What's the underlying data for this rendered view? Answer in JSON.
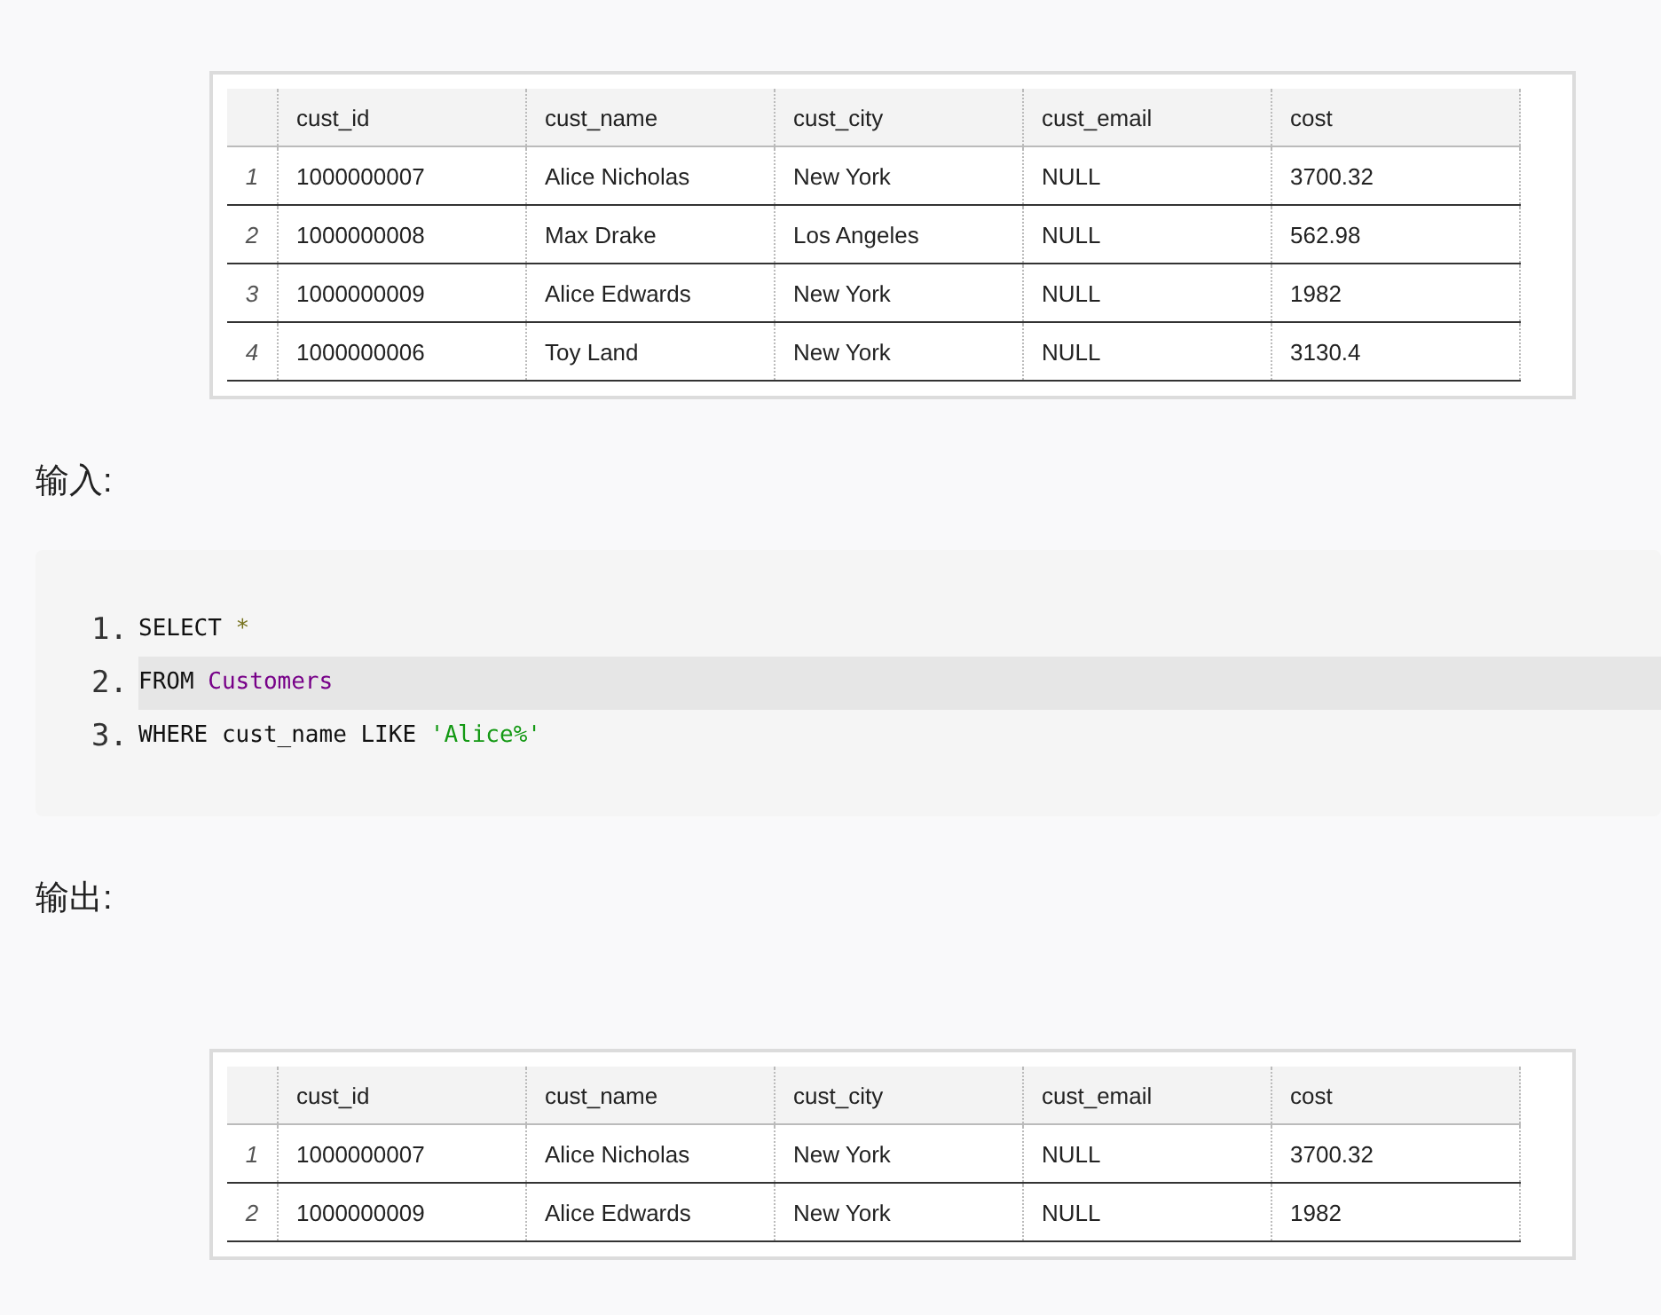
{
  "tables": [
    {
      "columns": [
        "cust_id",
        "cust_name",
        "cust_city",
        "cust_email",
        "cost"
      ],
      "rows": [
        {
          "num": "1",
          "cells": [
            "1000000007",
            "Alice Nicholas",
            "New York",
            "NULL",
            "3700.32"
          ]
        },
        {
          "num": "2",
          "cells": [
            "1000000008",
            "Max Drake",
            "Los Angeles",
            "NULL",
            "562.98"
          ]
        },
        {
          "num": "3",
          "cells": [
            "1000000009",
            "Alice Edwards",
            "New York",
            "NULL",
            "1982"
          ]
        },
        {
          "num": "4",
          "cells": [
            "1000000006",
            "Toy Land",
            "New York",
            "NULL",
            "3130.4"
          ]
        }
      ]
    }
  ],
  "input_label": "输入:",
  "code": {
    "lines": [
      {
        "number": "1.",
        "highlighted": false,
        "tokens": [
          {
            "text": "SELECT ",
            "kind": "plain"
          },
          {
            "text": "*",
            "kind": "operator"
          }
        ]
      },
      {
        "number": "2.",
        "highlighted": true,
        "tokens": [
          {
            "text": "FROM ",
            "kind": "plain"
          },
          {
            "text": "Customers",
            "kind": "identifier"
          }
        ]
      },
      {
        "number": "3.",
        "highlighted": false,
        "tokens": [
          {
            "text": "WHERE cust_name LIKE ",
            "kind": "plain"
          },
          {
            "text": "'Alice%'",
            "kind": "string"
          }
        ]
      }
    ]
  },
  "output_label": "输出:",
  "output_tables": [
    {
      "columns": [
        "cust_id",
        "cust_name",
        "cust_city",
        "cust_email",
        "cost"
      ],
      "rows": [
        {
          "num": "1",
          "cells": [
            "1000000007",
            "Alice Nicholas",
            "New York",
            "NULL",
            "3700.32"
          ]
        },
        {
          "num": "2",
          "cells": [
            "1000000009",
            "Alice Edwards",
            "New York",
            "NULL",
            "1982"
          ]
        }
      ]
    }
  ]
}
